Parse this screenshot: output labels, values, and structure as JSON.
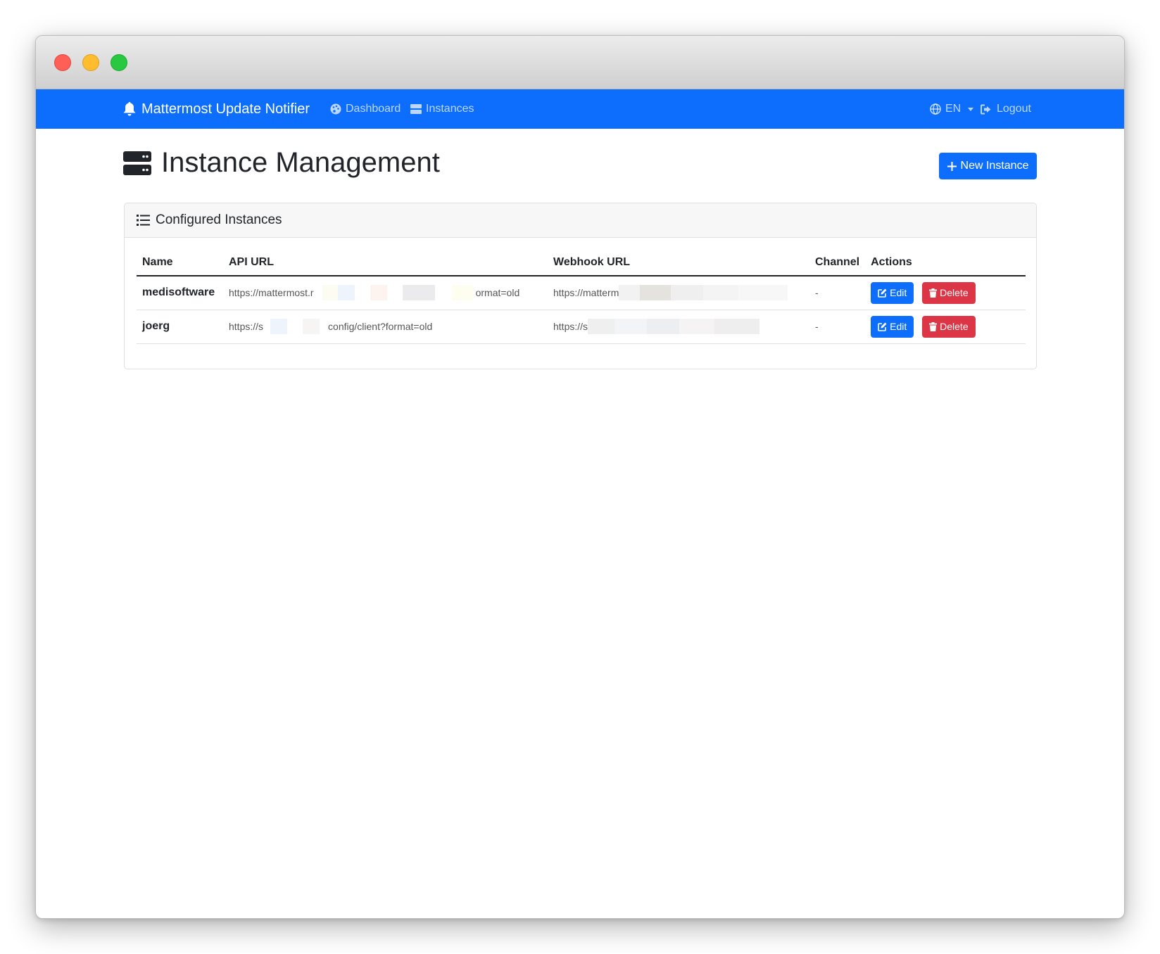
{
  "navbar": {
    "brand": "Mattermost Update Notifier",
    "links": [
      {
        "label": "Dashboard",
        "icon": "palette-icon"
      },
      {
        "label": "Instances",
        "icon": "server-icon"
      }
    ],
    "language": "EN",
    "logout": "Logout"
  },
  "page": {
    "title": "Instance Management",
    "new_button": "New Instance"
  },
  "card": {
    "title": "Configured Instances"
  },
  "table": {
    "headers": [
      "Name",
      "API URL",
      "Webhook URL",
      "Channel",
      "Actions"
    ],
    "rows": [
      {
        "name": "medisoftware",
        "api_url_prefix": "https://mattermost.r",
        "api_url_suffix": "ormat=old",
        "webhook_prefix": "https://matterm",
        "channel": "-",
        "edit": "Edit",
        "delete": "Delete"
      },
      {
        "name": "joerg",
        "api_url_prefix": "https://s",
        "api_url_suffix": "config/client?format=old",
        "webhook_prefix": "https://s",
        "channel": "-",
        "edit": "Edit",
        "delete": "Delete"
      }
    ]
  },
  "colors": {
    "primary": "#0d6efd",
    "danger": "#dc3545"
  }
}
